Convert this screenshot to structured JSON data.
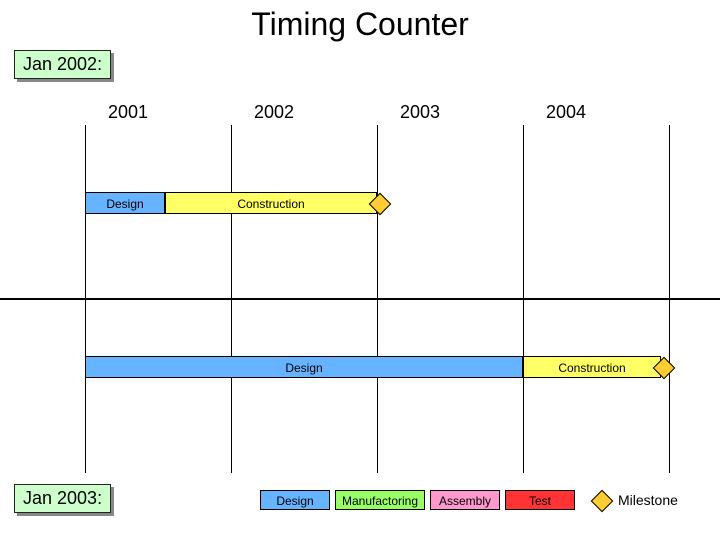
{
  "title": "Timing Counter",
  "tag_top": "Jan 2002:",
  "tag_bottom": "Jan 2003:",
  "years": [
    "2001",
    "2002",
    "2003",
    "2004"
  ],
  "row1": {
    "design": "Design",
    "construction": "Construction"
  },
  "row2": {
    "design": "Design",
    "construction": "Construction"
  },
  "legend": {
    "design": "Design",
    "manufactoring": "Manufactoring",
    "assembly": "Assembly",
    "test": "Test",
    "milestone": "Milestone"
  },
  "chart_data": {
    "type": "bar",
    "title": "Timing Counter",
    "x_axis": {
      "unit": "year",
      "start": 2001,
      "end": 2005,
      "ticks": [
        2001,
        2002,
        2003,
        2004
      ]
    },
    "tracks": [
      {
        "name": "Jan 2002 plan",
        "bars": [
          {
            "label": "Design",
            "start": 2001.0,
            "end": 2001.55,
            "category": "Design"
          },
          {
            "label": "Construction",
            "start": 2001.55,
            "end": 2003.0,
            "category": "Construction"
          }
        ],
        "milestones": [
          {
            "at": 2003.0
          }
        ]
      },
      {
        "name": "Jan 2003 plan",
        "bars": [
          {
            "label": "Design",
            "start": 2001.0,
            "end": 2004.0,
            "category": "Design"
          },
          {
            "label": "Construction",
            "start": 2004.0,
            "end": 2004.95,
            "category": "Construction"
          }
        ],
        "milestones": [
          {
            "at": 2004.95
          }
        ]
      }
    ],
    "legend": [
      "Design",
      "Manufactoring",
      "Assembly",
      "Test",
      "Milestone"
    ]
  }
}
